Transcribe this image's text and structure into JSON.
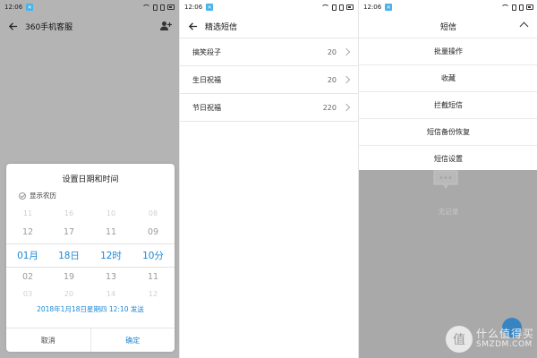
{
  "status_time": "12:06",
  "status_app_badge": "✕",
  "panel1": {
    "title": "360手机客服",
    "dialog": {
      "title": "设置日期和时间",
      "lunar_label": "显示农历",
      "columns": [
        [
          "11",
          "12",
          "01月",
          "02",
          "03"
        ],
        [
          "16",
          "17",
          "18日",
          "19",
          "20"
        ],
        [
          "10",
          "11",
          "12时",
          "13",
          "14"
        ],
        [
          "08",
          "09",
          "10分",
          "11",
          "12"
        ]
      ],
      "summary": "2018年1月18日星期四 12:10 发送",
      "cancel_label": "取消",
      "ok_label": "确定"
    }
  },
  "panel2": {
    "title": "精选短信",
    "items": [
      {
        "label": "搞笑段子",
        "count": "20"
      },
      {
        "label": "生日祝福",
        "count": "20"
      },
      {
        "label": "节日祝福",
        "count": "220"
      }
    ]
  },
  "panel3": {
    "title": "短信",
    "menu": [
      "批量操作",
      "收藏",
      "拦截短信",
      "短信备份恢复",
      "短信设置"
    ],
    "empty_text": "无记录"
  },
  "watermark": {
    "logo_char": "值",
    "cn": "什么值得买",
    "en": "SMZDM.COM"
  },
  "colors": {
    "accent": "#1b88d2",
    "overlay": "#b4b4b4"
  }
}
